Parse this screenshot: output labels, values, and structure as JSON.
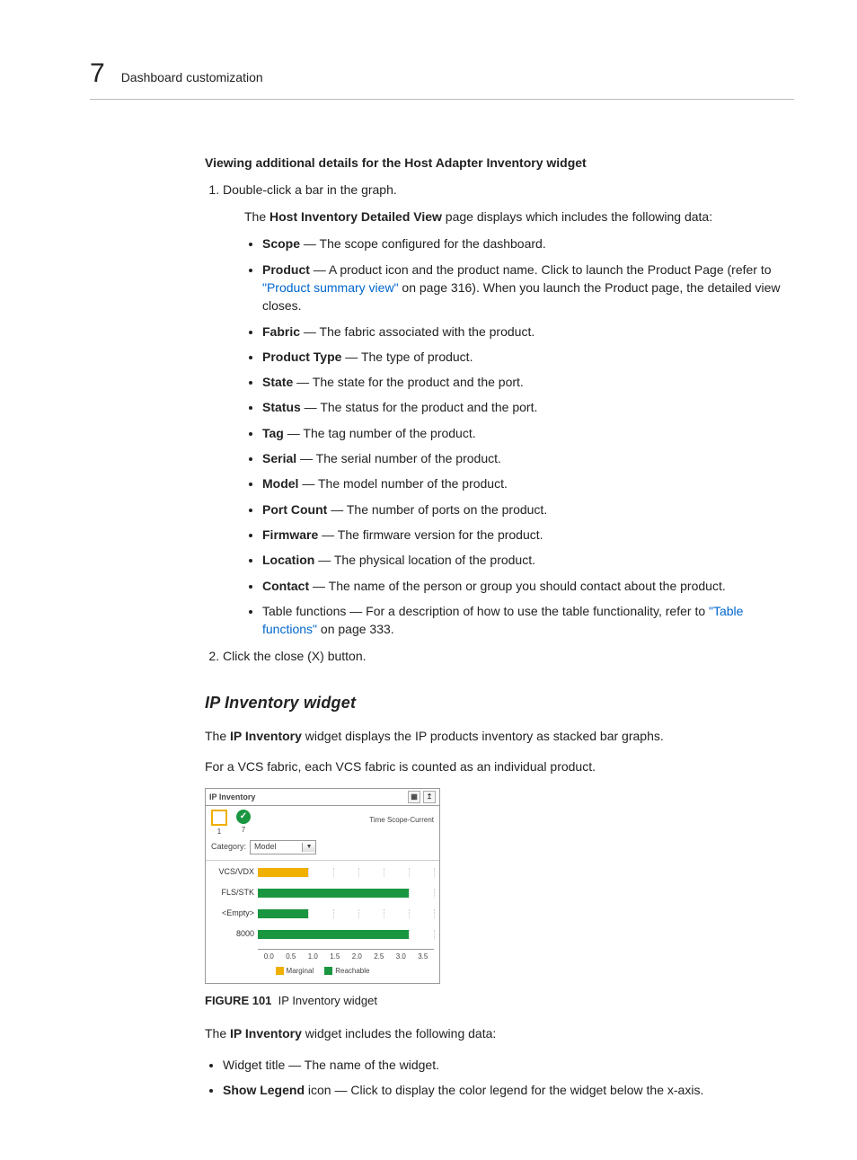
{
  "page": {
    "number": "7",
    "title": "Dashboard customization"
  },
  "section": {
    "heading": "Viewing additional details for the Host Adapter Inventory widget",
    "step1": "Double-click a bar in the graph.",
    "step1_sub_pre": "The ",
    "step1_sub_bold": "Host Inventory Detailed View",
    "step1_sub_post": " page displays which includes the following data:",
    "bullets": [
      {
        "term": "Scope",
        "desc": " — The scope configured for the dashboard."
      },
      {
        "term": "Product",
        "desc_pre": " — A product icon and the product name. Click to launch the Product Page (refer to ",
        "link": "\"Product summary view\"",
        "desc_post": " on page 316). When you launch the Product page, the detailed view closes."
      },
      {
        "term": "Fabric",
        "desc": " — The fabric associated with the product."
      },
      {
        "term": "Product Type",
        "desc": " — The type of product."
      },
      {
        "term": "State",
        "desc": " — The state for the product and the port."
      },
      {
        "term": "Status",
        "desc": " — The status for the product and the port."
      },
      {
        "term": "Tag",
        "desc": " — The tag number of the product."
      },
      {
        "term": "Serial",
        "desc": " — The serial number of the product."
      },
      {
        "term": "Model",
        "desc": " — The model number of the product."
      },
      {
        "term": "Port Count",
        "desc": " — The number of ports on the product."
      },
      {
        "term": "Firmware",
        "desc": " — The firmware version for the product."
      },
      {
        "term": "Location",
        "desc": " — The physical location of the product."
      },
      {
        "term": "Contact",
        "desc": " — The name of the person or group you should contact about the product."
      },
      {
        "plain_pre": "Table functions — For a description of how to use the table functionality, refer to ",
        "link": "\"Table functions\"",
        "plain_post": " on page 333."
      }
    ],
    "step2": "Click the close (X) button."
  },
  "ip_section": {
    "heading": "IP Inventory widget",
    "intro_pre": "The ",
    "intro_bold": "IP Inventory",
    "intro_post": " widget displays the IP products inventory as stacked bar graphs.",
    "intro2": "For a VCS fabric, each VCS fabric is counted as an individual product.",
    "fig_num": "FIGURE 101",
    "fig_caption": "IP Inventory widget",
    "after_pre": "The ",
    "after_bold": "IP Inventory",
    "after_post": " widget includes the following data:",
    "after_bullets": [
      {
        "plain": "Widget title — The name of the widget."
      },
      {
        "term": "Show Legend",
        "desc": " icon — Click to display the color legend for the widget below the x-axis."
      }
    ]
  },
  "widget": {
    "title": "IP Inventory",
    "scope": "Time Scope-Current",
    "status_marginal": "1",
    "status_reachable": "7",
    "category_label": "Category:",
    "category_value": "Model",
    "legend_marginal": "Marginal",
    "legend_reachable": "Reachable",
    "checkmark": "✓"
  },
  "chart_data": {
    "type": "bar",
    "orientation": "horizontal",
    "stacked": true,
    "categories": [
      "VCS/VDX",
      "FLS/STK",
      "<Empty>",
      "8000"
    ],
    "series": [
      {
        "name": "Marginal",
        "color": "#f0b000",
        "values": [
          1,
          0,
          0,
          0
        ]
      },
      {
        "name": "Reachable",
        "color": "#1a9640",
        "values": [
          0,
          3,
          1,
          3
        ]
      }
    ],
    "xlim": [
      0.0,
      3.5
    ],
    "xticks": [
      "0.0",
      "0.5",
      "1.0",
      "1.5",
      "2.0",
      "2.5",
      "3.0",
      "3.5"
    ],
    "title": "IP Inventory",
    "xlabel": "",
    "ylabel": ""
  }
}
